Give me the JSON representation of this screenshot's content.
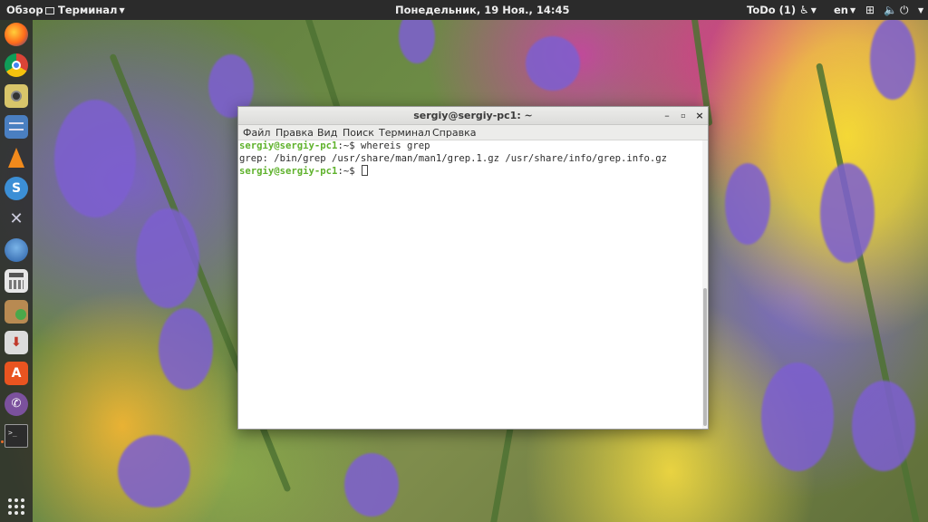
{
  "topbar": {
    "overview": "Обзор",
    "app_menu": "Терминал",
    "clock": "Понедельник, 19 Ноя., 14:45",
    "todo": "ToDo (1)",
    "lang": "en"
  },
  "dock": {
    "items": [
      {
        "name": "firefox",
        "icon": "firefox-icon"
      },
      {
        "name": "chrome",
        "icon": "chrome-icon"
      },
      {
        "name": "rhythmbox",
        "icon": "music-player-icon"
      },
      {
        "name": "files",
        "icon": "file-cabinet-icon"
      },
      {
        "name": "vlc",
        "icon": "vlc-cone-icon"
      },
      {
        "name": "simplenote",
        "icon": "simplenote-icon"
      },
      {
        "name": "tools",
        "icon": "tools-icon"
      },
      {
        "name": "thunderbird",
        "icon": "mail-bird-icon"
      },
      {
        "name": "calculator",
        "icon": "calculator-icon"
      },
      {
        "name": "archive-manager",
        "icon": "archive-icon"
      },
      {
        "name": "installer",
        "icon": "download-installer-icon"
      },
      {
        "name": "software",
        "icon": "software-center-icon"
      },
      {
        "name": "viber",
        "icon": "viber-icon"
      },
      {
        "name": "terminal",
        "icon": "terminal-icon"
      }
    ],
    "show_apps_icon": "app-grid-icon"
  },
  "terminal": {
    "title": "sergiy@sergiy-pc1: ~",
    "menu": [
      "Файл",
      "Правка",
      "Вид",
      "Поиск",
      "Терминал",
      "Справка"
    ],
    "lines": [
      {
        "user": "sergiy@sergiy-pc1",
        "path": ":~$ ",
        "cmd": "whereis grep"
      },
      {
        "output": "grep: /bin/grep /usr/share/man/man1/grep.1.gz /usr/share/info/grep.info.gz"
      },
      {
        "user": "sergiy@sergiy-pc1",
        "path": ":~$ ",
        "cmd": ""
      }
    ]
  },
  "colors": {
    "prompt_user": "#5fb22c",
    "topbar_bg": "#2b2b2b",
    "dock_bg": "#282828"
  }
}
